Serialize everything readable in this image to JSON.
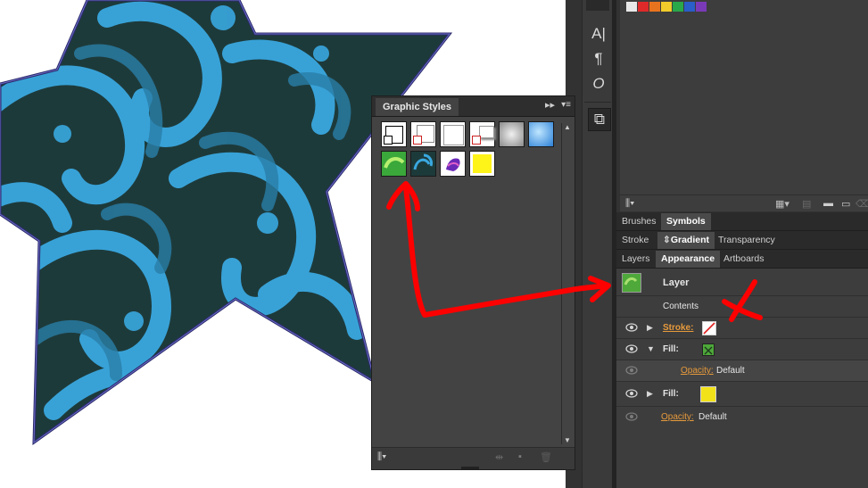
{
  "graphic_styles": {
    "tab_label": "Graphic Styles",
    "collapse_icon": "double-chevron-right-icon",
    "menu_icon": "panel-menu-icon",
    "swatches": [
      {
        "name": "default-style-icon",
        "kind": "default"
      },
      {
        "name": "no-stroke-style-icon",
        "kind": "default2"
      },
      {
        "name": "white-style-icon",
        "kind": "white"
      },
      {
        "name": "shadow-style-icon",
        "kind": "shadow"
      },
      {
        "name": "gray-gradient-style-icon",
        "kind": "gray"
      },
      {
        "name": "blue-gradient-style-icon",
        "kind": "blue"
      },
      {
        "name": "green-pattern-style-icon",
        "kind": "green"
      },
      {
        "name": "blue-pattern-style-icon",
        "kind": "bluepattern"
      },
      {
        "name": "purple-splash-style-icon",
        "kind": "purple"
      },
      {
        "name": "yellow-style-icon",
        "kind": "yellow"
      }
    ]
  },
  "tools": [
    {
      "name": "character-icon",
      "glyph": "A|"
    },
    {
      "name": "paragraph-icon",
      "glyph": "¶"
    },
    {
      "name": "opentype-icon",
      "glyph": "O"
    },
    {
      "name": "transform-icon",
      "glyph": "⧉"
    }
  ],
  "swatch_strip_colors": [
    "#e8e8e8",
    "#e02a2a",
    "#e8731e",
    "#f2cc2a",
    "#2aa84a",
    "#2a5ec8",
    "#7a3ab8"
  ],
  "tabs_row1": [
    "Brushes",
    "Symbols"
  ],
  "tabs_row2": [
    "Stroke",
    "Gradient",
    "Transparency"
  ],
  "tabs_row3": [
    "Layers",
    "Appearance",
    "Artboards"
  ],
  "appearance": {
    "target": "Layer",
    "contents": "Contents",
    "stroke_label": "Stroke:",
    "fill1_label": "Fill:",
    "opacity1_label": "Opacity:",
    "opacity1_value": "Default",
    "fill2_label": "Fill:",
    "opacity2_label": "Opacity:",
    "opacity2_value": "Default"
  },
  "colors": {
    "accent_orange": "#e69a3c",
    "annotation_red": "#ff0000",
    "star_blue": "#3aa8e0",
    "star_dark": "#1d3a3a"
  }
}
